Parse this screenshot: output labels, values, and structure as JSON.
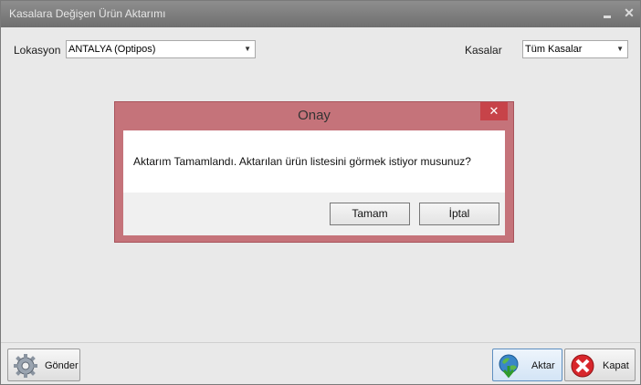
{
  "window": {
    "title": "Kasalara Değişen Ürün Aktarımı"
  },
  "filters": {
    "lokasyon_label": "Lokasyon",
    "lokasyon_value": "ANTALYA (Optipos)",
    "kasalar_label": "Kasalar",
    "kasalar_value": "Tüm Kasalar"
  },
  "bottom": {
    "gonder_label": "Gönder",
    "aktar_label": "Aktar",
    "kapat_label": "Kapat"
  },
  "dialog": {
    "title": "Onay",
    "close_glyph": "✕",
    "message": "Aktarım Tamamlandı. Aktarılan ürün listesini görmek istiyor musunuz?",
    "ok_label": "Tamam",
    "cancel_label": "İptal"
  },
  "colors": {
    "dialog_frame": "#c5737a",
    "dialog_close": "#c74349",
    "titlebar": "#7f7f7f"
  },
  "icons": [
    "gear-icon",
    "download-icon",
    "cancel-icon",
    "minimize-icon",
    "close-icon",
    "chevron-down-icon"
  ]
}
